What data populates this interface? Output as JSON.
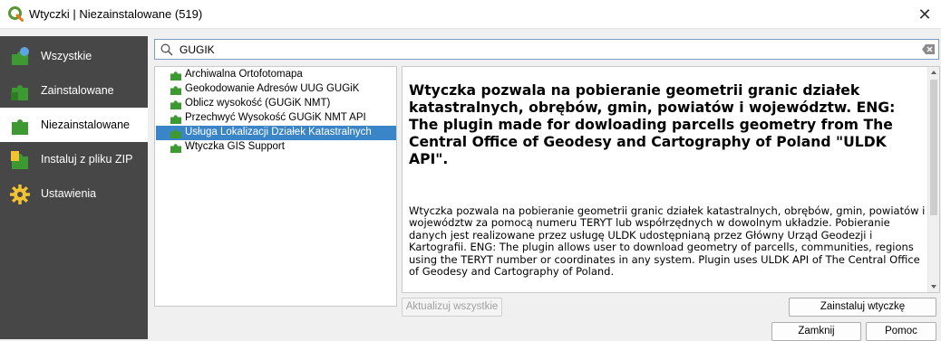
{
  "window": {
    "title": "Wtyczki | Niezainstalowane (519)",
    "close_glyph": "✕"
  },
  "sidebar": {
    "items": [
      {
        "label": "Wszystkie",
        "icon": "all-plugins-icon"
      },
      {
        "label": "Zainstalowane",
        "icon": "installed-plugins-icon"
      },
      {
        "label": "Niezainstalowane",
        "icon": "not-installed-plugins-icon",
        "active": true
      },
      {
        "label": "Instaluj z pliku ZIP",
        "icon": "install-zip-icon"
      },
      {
        "label": "Ustawienia",
        "icon": "settings-gear-icon"
      }
    ]
  },
  "search": {
    "value": "GUGIK"
  },
  "plugins": [
    {
      "name": "Archiwalna Ortofotomapa"
    },
    {
      "name": "Geokodowanie Adresów UUG GUGiK"
    },
    {
      "name": "Oblicz wysokość (GUGiK NMT)"
    },
    {
      "name": "Przechwyć Wysokość GUGiK NMT API"
    },
    {
      "name": "Usługa Lokalizacji Działek Katastralnych",
      "selected": true
    },
    {
      "name": "Wtyczka GIS Support"
    }
  ],
  "details": {
    "heading": "Wtyczka pozwala na pobieranie geometrii granic działek katastralnych, obrębów, gmin, powiatów i województw. ENG: The plugin made for dowloading parcells geometry from The Central Office of Geodesy and Cartography of Poland \"ULDK API\".",
    "description": "Wtyczka pozwala na pobieranie geometrii granic działek katastralnych, obrębów, gmin, powiatów i województw za pomocą numeru TERYT lub współrzędnych w dowolnym układzie. Pobieranie danych jest realizowane przez usługę ULDK udostępnianą przez Główny Urząd Geodezji i Kartografii. ENG: The plugin allows user to download geometry of parcells, communities, regions using the TERYT number or coordinates in any system. Plugin uses ULDK API of The Central Office of Geodesy and Cartography of Poland."
  },
  "buttons": {
    "update_all": "Aktualizuj wszystkie",
    "install": "Zainstaluj wtyczkę",
    "close": "Zamknij",
    "help": "Pomoc"
  },
  "colors": {
    "sidebar_bg": "#474747",
    "selection": "#3a84c8",
    "plugin_icon": "#3d9a32"
  }
}
